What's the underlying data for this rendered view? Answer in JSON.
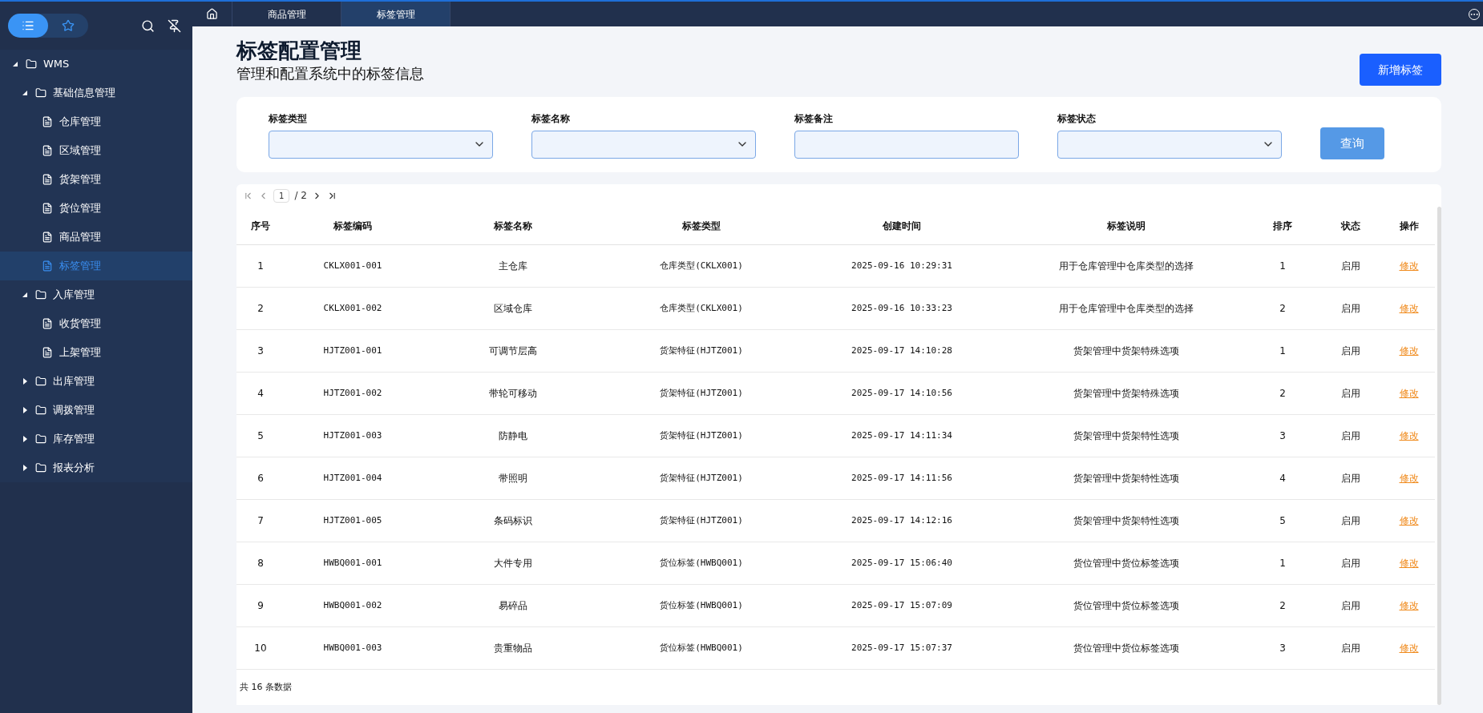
{
  "sidebar": {
    "modes": [
      {
        "kind": "list",
        "selected": true
      },
      {
        "kind": "favorites",
        "selected": false
      }
    ],
    "tree": [
      {
        "label": "WMS",
        "kind": "folder",
        "expanded": true,
        "selected": false,
        "children": [
          {
            "label": "基础信息管理",
            "kind": "folder",
            "expanded": true,
            "selected": false,
            "children": [
              {
                "label": "仓库管理",
                "kind": "page",
                "selected": false
              },
              {
                "label": "区域管理",
                "kind": "page",
                "selected": false
              },
              {
                "label": "货架管理",
                "kind": "page",
                "selected": false
              },
              {
                "label": "货位管理",
                "kind": "page",
                "selected": false
              },
              {
                "label": "商品管理",
                "kind": "page",
                "selected": false
              },
              {
                "label": "标签管理",
                "kind": "page",
                "selected": true
              }
            ]
          },
          {
            "label": "入库管理",
            "kind": "folder",
            "expanded": true,
            "selected": false,
            "children": [
              {
                "label": "收货管理",
                "kind": "page",
                "selected": false
              },
              {
                "label": "上架管理",
                "kind": "page",
                "selected": false
              }
            ]
          },
          {
            "label": "出库管理",
            "kind": "folder",
            "expanded": false,
            "selected": false
          },
          {
            "label": "调拨管理",
            "kind": "folder",
            "expanded": false,
            "selected": false
          },
          {
            "label": "库存管理",
            "kind": "folder",
            "expanded": false,
            "selected": false
          },
          {
            "label": "报表分析",
            "kind": "folder",
            "expanded": false,
            "selected": false
          }
        ]
      }
    ]
  },
  "tabs": [
    {
      "label": "商品管理",
      "selected": false
    },
    {
      "label": "标签管理",
      "selected": true
    }
  ],
  "page": {
    "title": "标签配置管理",
    "subtitle": "管理和配置系统中的标签信息",
    "add_button": "新增标签"
  },
  "filters": [
    {
      "label": "标签类型",
      "kind": "select"
    },
    {
      "label": "标签名称",
      "kind": "select"
    },
    {
      "label": "标签备注",
      "kind": "input"
    },
    {
      "label": "标签状态",
      "kind": "select"
    }
  ],
  "query_button": "查询",
  "pager": {
    "page": "1",
    "total": "/ 2"
  },
  "table": {
    "columns": [
      "序号",
      "标签编码",
      "标签名称",
      "标签类型",
      "创建时间",
      "标签说明",
      "排序",
      "状态",
      "操作"
    ],
    "rows": [
      [
        "1",
        "CKLX001-001",
        "主仓库",
        "仓库类型(CKLX001)",
        "2025-09-16 10:29:31",
        "用于仓库管理中仓库类型的选择",
        "1",
        "启用",
        "修改"
      ],
      [
        "2",
        "CKLX001-002",
        "区域仓库",
        "仓库类型(CKLX001)",
        "2025-09-16 10:33:23",
        "用于仓库管理中仓库类型的选择",
        "2",
        "启用",
        "修改"
      ],
      [
        "3",
        "HJTZ001-001",
        "可调节层高",
        "货架特征(HJTZ001)",
        "2025-09-17 14:10:28",
        "货架管理中货架特殊选项",
        "1",
        "启用",
        "修改"
      ],
      [
        "4",
        "HJTZ001-002",
        "带轮可移动",
        "货架特征(HJTZ001)",
        "2025-09-17 14:10:56",
        "货架管理中货架特殊选项",
        "2",
        "启用",
        "修改"
      ],
      [
        "5",
        "HJTZ001-003",
        "防静电",
        "货架特征(HJTZ001)",
        "2025-09-17 14:11:34",
        "货架管理中货架特性选项",
        "3",
        "启用",
        "修改"
      ],
      [
        "6",
        "HJTZ001-004",
        "带照明",
        "货架特征(HJTZ001)",
        "2025-09-17 14:11:56",
        "货架管理中货架特性选项",
        "4",
        "启用",
        "修改"
      ],
      [
        "7",
        "HJTZ001-005",
        "条码标识",
        "货架特征(HJTZ001)",
        "2025-09-17 14:12:16",
        "货架管理中货架特性选项",
        "5",
        "启用",
        "修改"
      ],
      [
        "8",
        "HWBQ001-001",
        "大件专用",
        "货位标签(HWBQ001)",
        "2025-09-17 15:06:40",
        "货位管理中货位标签选项",
        "1",
        "启用",
        "修改"
      ],
      [
        "9",
        "HWBQ001-002",
        "易碎品",
        "货位标签(HWBQ001)",
        "2025-09-17 15:07:09",
        "货位管理中货位标签选项",
        "2",
        "启用",
        "修改"
      ],
      [
        "10",
        "HWBQ001-003",
        "贵重物品",
        "货位标签(HWBQ001)",
        "2025-09-17 15:07:37",
        "货位管理中货位标签选项",
        "3",
        "启用",
        "修改"
      ]
    ],
    "footer": "共 16 条数据"
  }
}
